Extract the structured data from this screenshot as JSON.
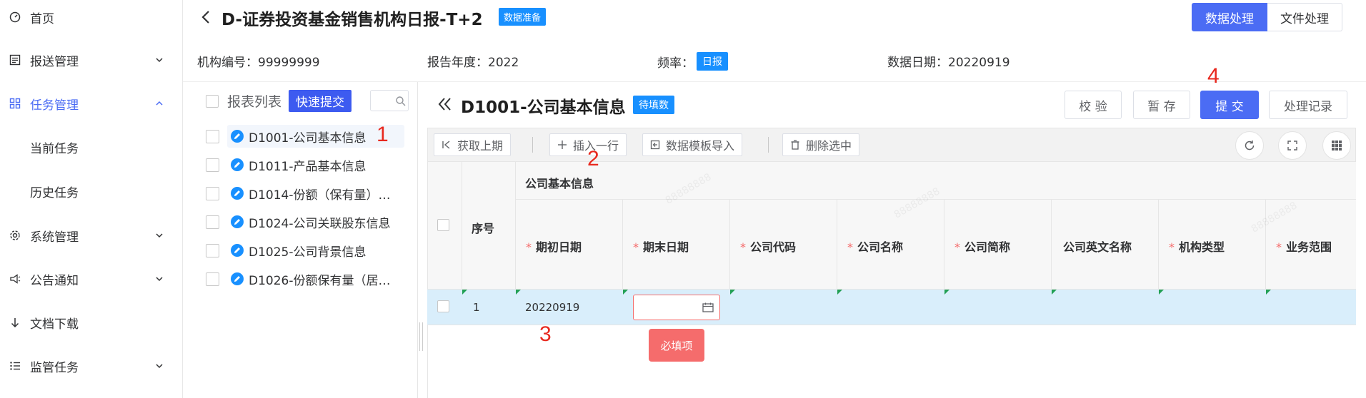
{
  "sidebar": {
    "items": [
      {
        "label": "首页",
        "icon": "dashboard-icon"
      },
      {
        "label": "报送管理",
        "icon": "list-icon"
      },
      {
        "label": "任务管理",
        "icon": "grid-icon",
        "active": true
      },
      {
        "label": "当前任务"
      },
      {
        "label": "历史任务"
      },
      {
        "label": "系统管理",
        "icon": "gear-icon"
      },
      {
        "label": "公告通知",
        "icon": "megaphone-icon"
      },
      {
        "label": "文档下载",
        "icon": "download-icon"
      },
      {
        "label": "监管任务",
        "icon": "list-icon"
      }
    ]
  },
  "header": {
    "title": "D-证券投资基金销售机构日报-T+2",
    "status_badge": "数据准备",
    "btn_data_process": "数据处理",
    "btn_file_process": "文件处理"
  },
  "meta": {
    "org_no": "机构编号：99999999",
    "report_year": "报告年度：2022",
    "freq_label": "频率：",
    "freq_badge": "日报",
    "data_date": "数据日期：20220919"
  },
  "report_list": {
    "header_label": "报表列表",
    "quick_submit": "快速提交",
    "items": [
      "D1001-公司基本信息",
      "D1011-产品基本信息",
      "D1014-份额（保有量）…",
      "D1024-公司关联股东信息",
      "D1025-公司背景信息",
      "D1026-份额保有量（居…"
    ]
  },
  "sheet": {
    "title": "D1001-公司基本信息",
    "badge": "待填数",
    "btn_validate": "校 验",
    "btn_save": "暂 存",
    "btn_submit": "提 交",
    "btn_history": "处理记录"
  },
  "toolbar": {
    "fetch_prev": "获取上期",
    "insert_row": "插入一行",
    "template_import": "数据模板导入",
    "delete_selected": "删除选中"
  },
  "table": {
    "group_header": "公司基本信息",
    "seq_header": "序号",
    "req_mark": "*",
    "columns": [
      {
        "label": "期初日期",
        "required": true
      },
      {
        "label": "期末日期",
        "required": true
      },
      {
        "label": "公司代码",
        "required": true
      },
      {
        "label": "公司名称",
        "required": true
      },
      {
        "label": "公司简称",
        "required": true
      },
      {
        "label": "公司英文名称",
        "required": false
      },
      {
        "label": "机构类型",
        "required": true
      },
      {
        "label": "业务范围",
        "required": true
      }
    ],
    "row": {
      "seq": "1",
      "start_date": "20220919"
    },
    "required_tip": "必填项"
  },
  "annotations": [
    "1",
    "2",
    "3",
    "4"
  ],
  "watermark": "88888888"
}
